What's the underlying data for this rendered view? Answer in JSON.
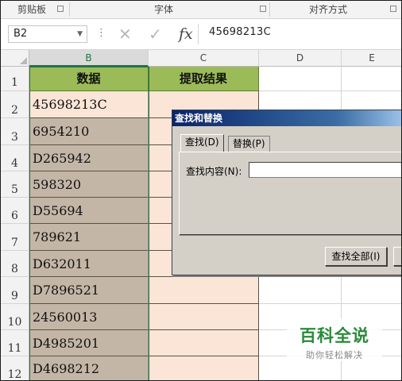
{
  "ribbon": {
    "groups": [
      "剪贴板",
      "字体",
      "对齐方式"
    ]
  },
  "formula_bar": {
    "name_box": "B2",
    "separator": "⋮",
    "cancel_icon": "✕",
    "enter_icon": "✓",
    "fx_label": "fx",
    "value": "45698213C"
  },
  "columns": [
    "B",
    "C",
    "D",
    "E"
  ],
  "rows": [
    "1",
    "2",
    "3",
    "4",
    "5",
    "6",
    "7",
    "8",
    "9",
    "10",
    "11",
    "12"
  ],
  "sheet": {
    "header_b": "数据",
    "header_c": "提取结果",
    "data_b": [
      "45698213C",
      "6954210",
      "D265942",
      "598320",
      "D55694",
      "789621",
      "D632011",
      "D7896521",
      "24560013",
      "D4985201",
      "D4698212"
    ]
  },
  "dialog": {
    "title": "查找和替换",
    "tab_find": "查找(D)",
    "tab_replace": "替换(P)",
    "find_label": "查找内容(N):",
    "find_value": "",
    "find_all_button": "查找全部(I)"
  },
  "watermark": {
    "title": "百科全说",
    "subtitle": "助你轻松解决"
  },
  "colors": {
    "header_green": "#9bbb59",
    "data_tan": "#c4b6a6",
    "result_peach": "#fbe5d6",
    "select_green": "#217346"
  }
}
